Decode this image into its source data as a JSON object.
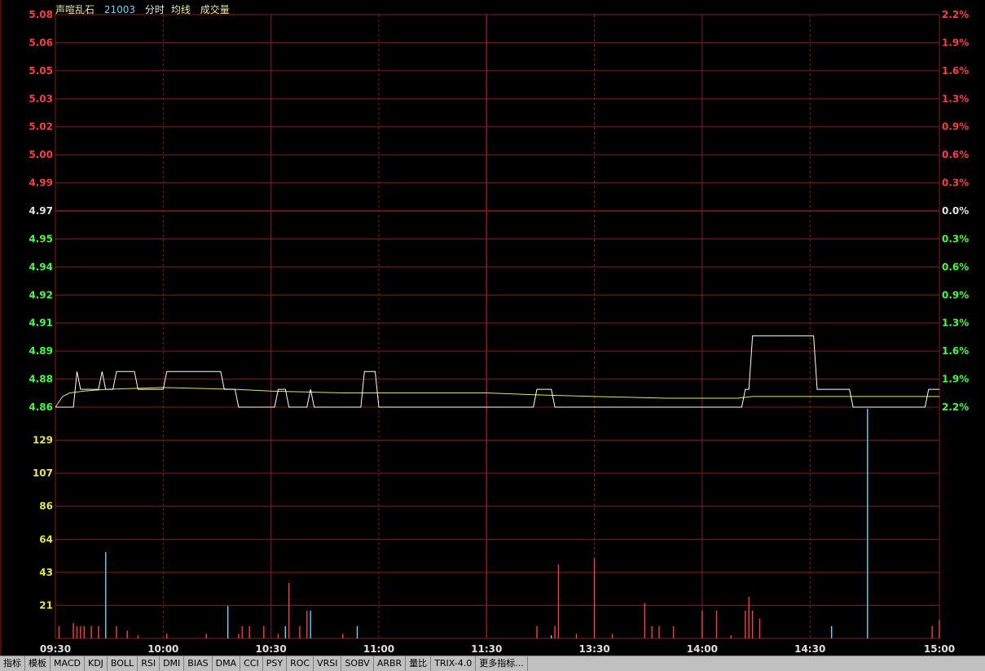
{
  "header": {
    "stock_name": "声喧乱石",
    "stock_code": "21003",
    "mode_label": "分时",
    "avg_label": "均线",
    "volume_label": "成交量"
  },
  "colors": {
    "up": "#ff3c3c",
    "down": "#3cff3c",
    "neutral": "#e0e0e0",
    "volume_axis": "#e8e840",
    "grid": "#8b1a1a",
    "price_line": "#ffffff",
    "avg_line": "#e8e840",
    "vol_up": "#ff3c3c",
    "vol_down": "#5fd7ff"
  },
  "chart_data": {
    "type": "line",
    "prev_close": 4.97,
    "price_axis": {
      "ticks": [
        "5.08",
        "5.06",
        "5.05",
        "5.03",
        "5.02",
        "5.00",
        "4.99",
        "4.97",
        "4.95",
        "4.94",
        "4.92",
        "4.91",
        "4.89",
        "4.88",
        "4.86"
      ],
      "ylim": [
        4.86,
        5.08
      ]
    },
    "pct_axis": {
      "ticks": [
        "2.2%",
        "1.9%",
        "1.6%",
        "1.3%",
        "0.9%",
        "0.6%",
        "0.3%",
        "0.0%",
        "0.3%",
        "0.6%",
        "0.9%",
        "1.3%",
        "1.6%",
        "1.9%",
        "2.2%"
      ]
    },
    "volume_axis": {
      "ticks": [
        "129",
        "107",
        "86",
        "64",
        "43",
        "21"
      ],
      "ylim": [
        0,
        150
      ]
    },
    "time_labels": [
      "09:30",
      "10:00",
      "10:30",
      "11:00",
      "11:30",
      "13:30",
      "14:00",
      "14:30",
      "15:00"
    ],
    "price_series": [
      [
        0,
        4.86
      ],
      [
        5,
        4.86
      ],
      [
        6,
        4.88
      ],
      [
        7,
        4.87
      ],
      [
        10,
        4.87
      ],
      [
        12,
        4.87
      ],
      [
        13,
        4.88
      ],
      [
        14,
        4.87
      ],
      [
        16,
        4.87
      ],
      [
        17,
        4.88
      ],
      [
        22,
        4.88
      ],
      [
        23,
        4.87
      ],
      [
        30,
        4.87
      ],
      [
        31,
        4.88
      ],
      [
        46,
        4.88
      ],
      [
        47,
        4.87
      ],
      [
        50,
        4.87
      ],
      [
        51,
        4.86
      ],
      [
        61,
        4.86
      ],
      [
        62,
        4.87
      ],
      [
        64,
        4.87
      ],
      [
        65,
        4.86
      ],
      [
        70,
        4.86
      ],
      [
        71,
        4.87
      ],
      [
        72,
        4.86
      ],
      [
        85,
        4.86
      ],
      [
        86,
        4.88
      ],
      [
        89,
        4.88
      ],
      [
        90,
        4.86
      ],
      [
        133,
        4.86
      ],
      [
        134,
        4.87
      ],
      [
        138,
        4.87
      ],
      [
        139,
        4.86
      ],
      [
        191,
        4.86
      ],
      [
        192,
        4.87
      ],
      [
        193,
        4.87
      ],
      [
        194,
        4.9
      ],
      [
        211,
        4.9
      ],
      [
        212,
        4.87
      ],
      [
        221,
        4.87
      ],
      [
        222,
        4.86
      ],
      [
        242,
        4.86
      ],
      [
        243,
        4.87
      ],
      [
        246,
        4.87
      ]
    ],
    "avg_series": [
      [
        0,
        4.86
      ],
      [
        2,
        4.866
      ],
      [
        4,
        4.868
      ],
      [
        8,
        4.869
      ],
      [
        14,
        4.87
      ],
      [
        30,
        4.871
      ],
      [
        50,
        4.87
      ],
      [
        60,
        4.869
      ],
      [
        80,
        4.868
      ],
      [
        120,
        4.868
      ],
      [
        133,
        4.867
      ],
      [
        150,
        4.866
      ],
      [
        170,
        4.865
      ],
      [
        190,
        4.865
      ],
      [
        194,
        4.866
      ],
      [
        215,
        4.866
      ],
      [
        240,
        4.866
      ],
      [
        246,
        4.866
      ]
    ],
    "volume_bars": [
      {
        "t": 1,
        "v": 8,
        "dir": "up"
      },
      {
        "t": 5,
        "v": 10,
        "dir": "up"
      },
      {
        "t": 6,
        "v": 8,
        "dir": "up"
      },
      {
        "t": 7,
        "v": 8,
        "dir": "up"
      },
      {
        "t": 8,
        "v": 8,
        "dir": "up"
      },
      {
        "t": 10,
        "v": 8,
        "dir": "up"
      },
      {
        "t": 12,
        "v": 8,
        "dir": "up"
      },
      {
        "t": 14,
        "v": 56,
        "dir": "down"
      },
      {
        "t": 17,
        "v": 8,
        "dir": "up"
      },
      {
        "t": 20,
        "v": 5,
        "dir": "up"
      },
      {
        "t": 23,
        "v": 2,
        "dir": "up"
      },
      {
        "t": 31,
        "v": 3,
        "dir": "up"
      },
      {
        "t": 42,
        "v": 3,
        "dir": "up"
      },
      {
        "t": 48,
        "v": 21,
        "dir": "down"
      },
      {
        "t": 51,
        "v": 3,
        "dir": "up"
      },
      {
        "t": 52,
        "v": 8,
        "dir": "up"
      },
      {
        "t": 54,
        "v": 8,
        "dir": "up"
      },
      {
        "t": 58,
        "v": 8,
        "dir": "up"
      },
      {
        "t": 62,
        "v": 3,
        "dir": "up"
      },
      {
        "t": 64,
        "v": 8,
        "dir": "down"
      },
      {
        "t": 65,
        "v": 36,
        "dir": "up"
      },
      {
        "t": 68,
        "v": 8,
        "dir": "up"
      },
      {
        "t": 70,
        "v": 18,
        "dir": "up"
      },
      {
        "t": 71,
        "v": 18,
        "dir": "down"
      },
      {
        "t": 80,
        "v": 3,
        "dir": "up"
      },
      {
        "t": 84,
        "v": 8,
        "dir": "down"
      },
      {
        "t": 134,
        "v": 8,
        "dir": "up"
      },
      {
        "t": 138,
        "v": 2,
        "dir": "down"
      },
      {
        "t": 139,
        "v": 8,
        "dir": "up"
      },
      {
        "t": 140,
        "v": 48,
        "dir": "up"
      },
      {
        "t": 145,
        "v": 3,
        "dir": "up"
      },
      {
        "t": 150,
        "v": 52,
        "dir": "up"
      },
      {
        "t": 155,
        "v": 3,
        "dir": "up"
      },
      {
        "t": 164,
        "v": 23,
        "dir": "up"
      },
      {
        "t": 166,
        "v": 8,
        "dir": "up"
      },
      {
        "t": 168,
        "v": 8,
        "dir": "up"
      },
      {
        "t": 172,
        "v": 8,
        "dir": "up"
      },
      {
        "t": 180,
        "v": 18,
        "dir": "up"
      },
      {
        "t": 184,
        "v": 18,
        "dir": "up"
      },
      {
        "t": 188,
        "v": 2,
        "dir": "up"
      },
      {
        "t": 192,
        "v": 18,
        "dir": "up"
      },
      {
        "t": 193,
        "v": 27,
        "dir": "up"
      },
      {
        "t": 194,
        "v": 18,
        "dir": "up"
      },
      {
        "t": 196,
        "v": 13,
        "dir": "up"
      },
      {
        "t": 216,
        "v": 8,
        "dir": "down"
      },
      {
        "t": 226,
        "v": 149,
        "dir": "down"
      },
      {
        "t": 244,
        "v": 8,
        "dir": "up"
      },
      {
        "t": 246,
        "v": 12,
        "dir": "up"
      }
    ]
  },
  "tabs": [
    "指标",
    "模板",
    "MACD",
    "KDJ",
    "BOLL",
    "RSI",
    "DMI",
    "BIAS",
    "DMA",
    "CCI",
    "PSY",
    "ROC",
    "VRSI",
    "SOBV",
    "ARBR",
    "量比",
    "TRIX-4.0",
    "更多指标..."
  ]
}
